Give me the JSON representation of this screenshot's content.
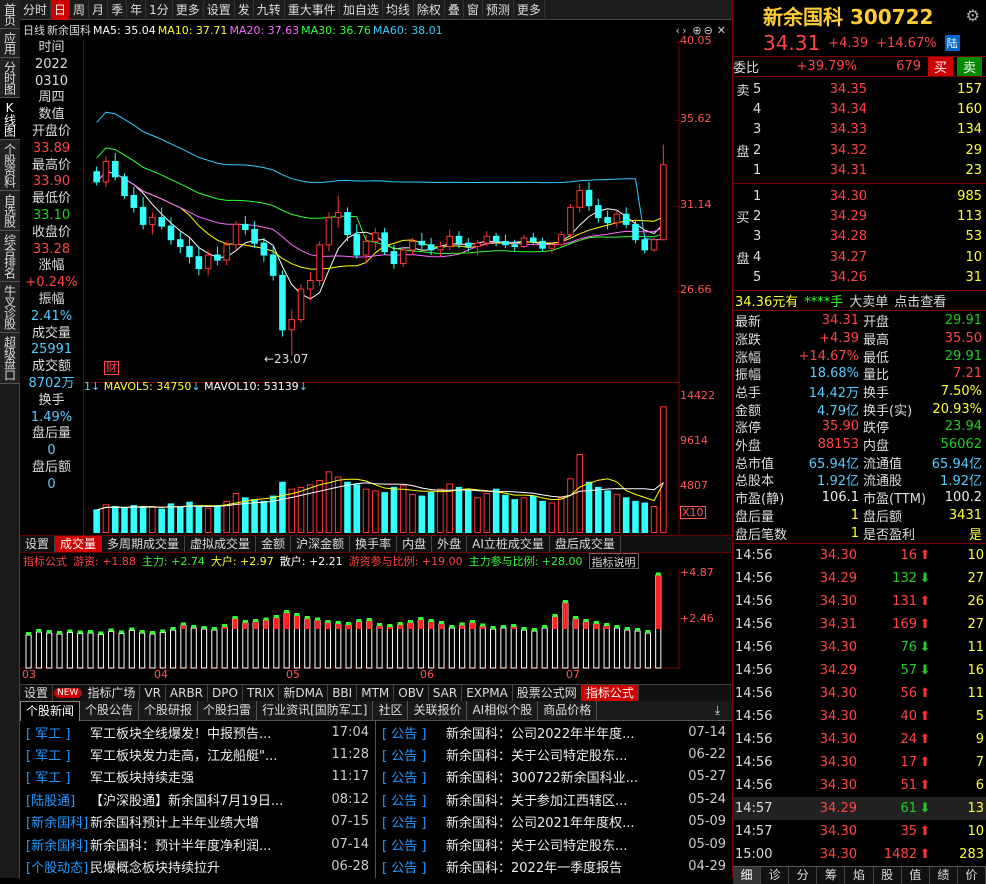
{
  "leftnav": [
    "首页",
    "应用",
    "分时图",
    "K线图",
    "个股资料",
    "自选股",
    "综合排名",
    "牛叉诊股",
    "超级盘口"
  ],
  "toolbar": [
    "分时",
    "日",
    "周",
    "月",
    "季",
    "年",
    "1分",
    "更多",
    "设置",
    "发",
    "九转",
    "重大事件",
    "加自选",
    "均线",
    "除权",
    "叠",
    "窗",
    "预测",
    "更多"
  ],
  "malegend": {
    "period": "日线",
    "name": "新余国科",
    "ma5": "MA5: 35.04",
    "ma10": "MA10: 37.71",
    "ma20": "MA20: 37.63",
    "ma30": "MA30: 36.76",
    "ma60": "MA60: 38.01"
  },
  "leftinfo": [
    {
      "l": "时间"
    },
    {
      "l": "2022"
    },
    {
      "l": "0310"
    },
    {
      "l": "周四"
    },
    {
      "l": "数值"
    },
    {
      "l": " "
    },
    {
      "l": "开盘价"
    },
    {
      "v": "33.89",
      "c": "r"
    },
    {
      "l": "最高价"
    },
    {
      "v": "33.90",
      "c": "r"
    },
    {
      "l": "最低价"
    },
    {
      "v": "33.10",
      "c": "g"
    },
    {
      "l": "收盘价"
    },
    {
      "v": "33.28",
      "c": "r"
    },
    {
      "l": "涨幅"
    },
    {
      "v": "+0.24%",
      "c": "r"
    },
    {
      "l": "振幅"
    },
    {
      "v": "2.41%",
      "c": "c"
    },
    {
      "l": "成交量"
    },
    {
      "v": "25991",
      "c": "c"
    },
    {
      "l": "成交额"
    },
    {
      "v": "8702万",
      "c": "c"
    },
    {
      "l": "换手"
    },
    {
      "v": "1.49%",
      "c": "c"
    },
    {
      "l": "盘后量"
    },
    {
      "v": "0",
      "c": "c"
    },
    {
      "l": "盘后额"
    },
    {
      "v": "0",
      "c": "c"
    }
  ],
  "yaxis1": [
    "40.05",
    "35.62",
    "31.14",
    "26.66"
  ],
  "lowlabel": "←23.07",
  "finmark": "财",
  "volegend": {
    "mavol5": "MAVOL5: 34750",
    "mavol10": "MAVOL10: 53139"
  },
  "yaxis2": [
    "14422",
    "9614",
    "4807",
    "X10"
  ],
  "subtabs": [
    "设置",
    "成交量",
    "多周期成交量",
    "虚拟成交量",
    "金额",
    "沪深金额",
    "换手率",
    "内盘",
    "外盘",
    "AI立桩成交量",
    "盘后成交量"
  ],
  "indline": {
    "name": "指标公式",
    "a": "游资: +1.88",
    "b": "主力: +2.74",
    "c": "大户: +2.97",
    "d": "散户: +2.21",
    "e": "游资参与比例: +19.00",
    "f": "主力参与比例: +28.00",
    "help": "指标说明"
  },
  "yaxis3": [
    "+4.87",
    "+2.46"
  ],
  "xaxis": [
    "03",
    "04",
    "05",
    "06",
    "07"
  ],
  "formulatabs": [
    "设置",
    "NEW",
    "指标广场",
    "VR",
    "ARBR",
    "DPO",
    "TRIX",
    "新DMA",
    "BBI",
    "MTM",
    "OBV",
    "SAR",
    "EXPMA",
    "股票公式网",
    "指标公式"
  ],
  "newstabs": [
    "个股新闻",
    "个股公告",
    "个股研报",
    "个股扫雷",
    "行业资讯[国防军工]",
    "社区",
    "关联报价",
    "AI相似个股",
    "商品价格"
  ],
  "newsleft": [
    {
      "tag": "[ 军工 ]",
      "title": "军工板块全线爆发！中报预告...",
      "time": "17:04"
    },
    {
      "tag": "[ 军工 ]",
      "title": "军工板块发力走高，江龙船艇\"...",
      "time": "11:28"
    },
    {
      "tag": "[ 军工 ]",
      "title": "军工板块持续走强",
      "time": "11:17"
    },
    {
      "tag": "[陆股通]",
      "title": "【沪深股通】新余国科7月19日...",
      "time": "08:12"
    },
    {
      "tag": "[新余国科]",
      "title": "新余国科预计上半年业绩大增",
      "time": "07-15"
    },
    {
      "tag": "[新余国科]",
      "title": "新余国科：预计半年度净利润...",
      "time": "07-14"
    },
    {
      "tag": "[个股动态]",
      "title": "民爆概念板块持续拉升",
      "time": "06-28"
    }
  ],
  "newsright": [
    {
      "tag": "[ 公告 ]",
      "title": "新余国科：公司2022年半年度...",
      "time": "07-14"
    },
    {
      "tag": "[ 公告 ]",
      "title": "新余国科：关于公司特定股东...",
      "time": "06-22"
    },
    {
      "tag": "[ 公告 ]",
      "title": "新余国科：300722新余国科业...",
      "time": "05-27"
    },
    {
      "tag": "[ 公告 ]",
      "title": "新余国科：关于参加江西辖区...",
      "time": "05-24"
    },
    {
      "tag": "[ 公告 ]",
      "title": "新余国科：公司2021年年度权...",
      "time": "05-09"
    },
    {
      "tag": "[ 公告 ]",
      "title": "新余国科：关于公司特定股东...",
      "time": "05-09"
    },
    {
      "tag": "[ 公告 ]",
      "title": "新余国科：2022年一季度报告",
      "time": "04-29"
    }
  ],
  "stock": {
    "name": "新余国科 300722",
    "price": "34.31",
    "chg": "+4.39",
    "pct": "+14.67%",
    "tag": "陆"
  },
  "weibi": {
    "label": "委比",
    "pct": "+39.79%",
    "diff": "679",
    "buy": "买",
    "sell": "卖"
  },
  "sells": [
    [
      "卖",
      "5",
      "34.35",
      "157"
    ],
    [
      "",
      "4",
      "34.34",
      "160"
    ],
    [
      "",
      "3",
      "34.33",
      "134"
    ],
    [
      "盘",
      "2",
      "34.32",
      "29"
    ],
    [
      "",
      "1",
      "34.31",
      "23"
    ]
  ],
  "buys": [
    [
      "",
      "1",
      "34.30",
      "985"
    ],
    [
      "买",
      "2",
      "34.29",
      "113"
    ],
    [
      "",
      "3",
      "34.28",
      "53"
    ],
    [
      "盘",
      "4",
      "34.27",
      "10"
    ],
    [
      "",
      "5",
      "34.26",
      "31"
    ]
  ],
  "bigorder": {
    "a": "34.36元有",
    "b": "****手",
    "c": "大卖单",
    "d": "点击查看"
  },
  "quote": [
    [
      "最新",
      "34.31",
      "r",
      "开盘",
      "29.91",
      "g"
    ],
    [
      "涨跌",
      "+4.39",
      "r",
      "最高",
      "35.50",
      "r"
    ],
    [
      "涨幅",
      "+14.67%",
      "r",
      "最低",
      "29.91",
      "g"
    ],
    [
      "振幅",
      "18.68%",
      "c",
      "量比",
      "7.21",
      "r"
    ],
    [
      "总手",
      "14.42万",
      "c",
      "换手",
      "7.50%",
      "y"
    ],
    [
      "金额",
      "4.79亿",
      "c",
      "换手(实)",
      "20.93%",
      "y"
    ],
    [
      "涨停",
      "35.90",
      "r",
      "跌停",
      "23.94",
      "g"
    ],
    [
      "外盘",
      "88153",
      "r",
      "内盘",
      "56062",
      "g"
    ],
    [
      "总市值",
      "65.94亿",
      "c",
      "流通值",
      "65.94亿",
      "c"
    ],
    [
      "总股本",
      "1.92亿",
      "c",
      "流通股",
      "1.92亿",
      "c"
    ],
    [
      "市盈(静)",
      "106.1",
      "w",
      "市盈(TTM)",
      "100.2",
      "w"
    ],
    [
      "盘后量",
      "1",
      "y",
      "盘后额",
      "3431",
      "y"
    ],
    [
      "盘后笔数",
      "1",
      "y",
      "是否盈利",
      "是",
      "y"
    ]
  ],
  "ticks": [
    [
      "14:56",
      "34.30",
      "16",
      "up",
      "10"
    ],
    [
      "14:56",
      "34.29",
      "132",
      "down",
      "27"
    ],
    [
      "14:56",
      "34.30",
      "131",
      "up",
      "26"
    ],
    [
      "14:56",
      "34.31",
      "169",
      "up",
      "27"
    ],
    [
      "14:56",
      "34.30",
      "76",
      "down",
      "11"
    ],
    [
      "14:56",
      "34.29",
      "57",
      "down",
      "16"
    ],
    [
      "14:56",
      "34.30",
      "56",
      "up",
      "11"
    ],
    [
      "14:56",
      "34.30",
      "40",
      "up",
      "5"
    ],
    [
      "14:56",
      "34.30",
      "24",
      "up",
      "9"
    ],
    [
      "14:56",
      "34.30",
      "17",
      "up",
      "7"
    ],
    [
      "14:56",
      "34.30",
      "51",
      "up",
      "6"
    ],
    [
      "14:57",
      "34.29",
      "61",
      "down",
      "13"
    ],
    [
      "14:57",
      "34.30",
      "35",
      "up",
      "10"
    ],
    [
      "15:00",
      "34.30",
      "1482",
      "up",
      "283"
    ]
  ],
  "bottomtabs": [
    "细",
    "诊",
    "分",
    "筹",
    "焰",
    "股",
    "值",
    "绩",
    "价"
  ],
  "colors": {
    "up": "#ff3333",
    "down": "#33ffff",
    "ma5": "#ffffff",
    "ma10": "#ffff00",
    "ma20": "#ff66ff",
    "ma30": "#33ff33",
    "ma60": "#33ccff"
  },
  "chart_data": {
    "type": "candlestick",
    "ylim": [
      21.5,
      41.5
    ],
    "candles": [
      [
        33.9,
        34.2,
        33.1,
        33.3
      ],
      [
        33.3,
        34.8,
        33.0,
        34.5
      ],
      [
        34.5,
        35.0,
        33.4,
        33.6
      ],
      [
        33.6,
        33.8,
        32.3,
        32.5
      ],
      [
        32.5,
        33.0,
        31.5,
        31.8
      ],
      [
        31.8,
        32.4,
        30.5,
        30.8
      ],
      [
        30.8,
        31.5,
        30.2,
        31.2
      ],
      [
        31.2,
        31.8,
        30.5,
        30.7
      ],
      [
        30.7,
        31.2,
        29.6,
        29.9
      ],
      [
        29.9,
        30.4,
        29.1,
        29.5
      ],
      [
        29.5,
        30.0,
        28.5,
        28.9
      ],
      [
        28.9,
        29.5,
        27.8,
        28.2
      ],
      [
        28.2,
        29.3,
        27.8,
        29.0
      ],
      [
        29.0,
        29.5,
        28.4,
        28.7
      ],
      [
        28.7,
        29.8,
        28.4,
        29.6
      ],
      [
        29.6,
        31.0,
        29.3,
        30.8
      ],
      [
        30.8,
        31.3,
        30.2,
        30.5
      ],
      [
        30.5,
        31.0,
        29.4,
        29.7
      ],
      [
        29.7,
        30.0,
        28.6,
        29.0
      ],
      [
        29.0,
        29.6,
        27.5,
        27.8
      ],
      [
        27.8,
        28.1,
        24.2,
        24.6
      ],
      [
        24.6,
        25.8,
        23.07,
        25.2
      ],
      [
        25.2,
        27.3,
        25.0,
        27.0
      ],
      [
        27.0,
        28.0,
        26.3,
        27.5
      ],
      [
        27.5,
        29.8,
        27.2,
        29.6
      ],
      [
        29.6,
        31.5,
        29.2,
        31.2
      ],
      [
        31.2,
        32.5,
        30.6,
        31.5
      ],
      [
        31.5,
        31.8,
        29.8,
        30.2
      ],
      [
        30.2,
        30.8,
        28.8,
        29.0
      ],
      [
        29.0,
        30.2,
        28.5,
        29.8
      ],
      [
        29.8,
        30.6,
        29.3,
        30.3
      ],
      [
        30.3,
        30.6,
        29.0,
        29.2
      ],
      [
        29.2,
        29.6,
        28.2,
        28.5
      ],
      [
        28.5,
        29.5,
        28.3,
        29.3
      ],
      [
        29.3,
        30.0,
        29.0,
        29.8
      ],
      [
        29.8,
        30.3,
        29.3,
        29.6
      ],
      [
        29.6,
        30.0,
        29.0,
        29.3
      ],
      [
        29.3,
        29.8,
        28.9,
        29.5
      ],
      [
        29.5,
        30.5,
        29.3,
        30.1
      ],
      [
        30.1,
        30.4,
        29.4,
        29.7
      ],
      [
        29.7,
        30.0,
        29.2,
        29.5
      ],
      [
        29.5,
        29.9,
        29.0,
        29.7
      ],
      [
        29.7,
        30.4,
        29.5,
        30.1
      ],
      [
        30.1,
        30.3,
        29.5,
        29.8
      ],
      [
        29.8,
        30.2,
        29.4,
        29.6
      ],
      [
        29.6,
        29.9,
        29.2,
        29.5
      ],
      [
        29.5,
        30.2,
        29.4,
        30.0
      ],
      [
        30.0,
        30.3,
        29.6,
        29.8
      ],
      [
        29.8,
        30.0,
        29.2,
        29.4
      ],
      [
        29.4,
        29.8,
        29.1,
        29.6
      ],
      [
        29.6,
        30.4,
        29.5,
        30.2
      ],
      [
        30.2,
        32.0,
        30.0,
        31.8
      ],
      [
        31.8,
        33.2,
        31.5,
        32.8
      ],
      [
        32.8,
        33.3,
        31.6,
        31.9
      ],
      [
        31.9,
        32.3,
        30.9,
        31.2
      ],
      [
        31.2,
        31.6,
        30.5,
        30.9
      ],
      [
        30.9,
        31.6,
        30.6,
        31.4
      ],
      [
        31.4,
        31.8,
        30.6,
        30.8
      ],
      [
        30.8,
        31.0,
        29.7,
        29.9
      ],
      [
        29.9,
        30.2,
        29.1,
        29.3
      ],
      [
        29.3,
        30.0,
        29.2,
        29.9
      ],
      [
        29.9,
        35.5,
        29.91,
        34.31
      ]
    ],
    "volume": [
      26,
      32,
      30,
      28,
      31,
      29,
      30,
      27,
      33,
      29,
      35,
      30,
      28,
      31,
      36,
      45,
      40,
      38,
      36,
      42,
      58,
      50,
      52,
      55,
      60,
      70,
      64,
      58,
      55,
      50,
      48,
      46,
      52,
      54,
      44,
      42,
      46,
      50,
      56,
      52,
      48,
      40,
      45,
      50,
      43,
      38,
      40,
      42,
      36,
      34,
      40,
      62,
      90,
      58,
      52,
      48,
      44,
      40,
      36,
      34,
      30,
      145
    ]
  }
}
